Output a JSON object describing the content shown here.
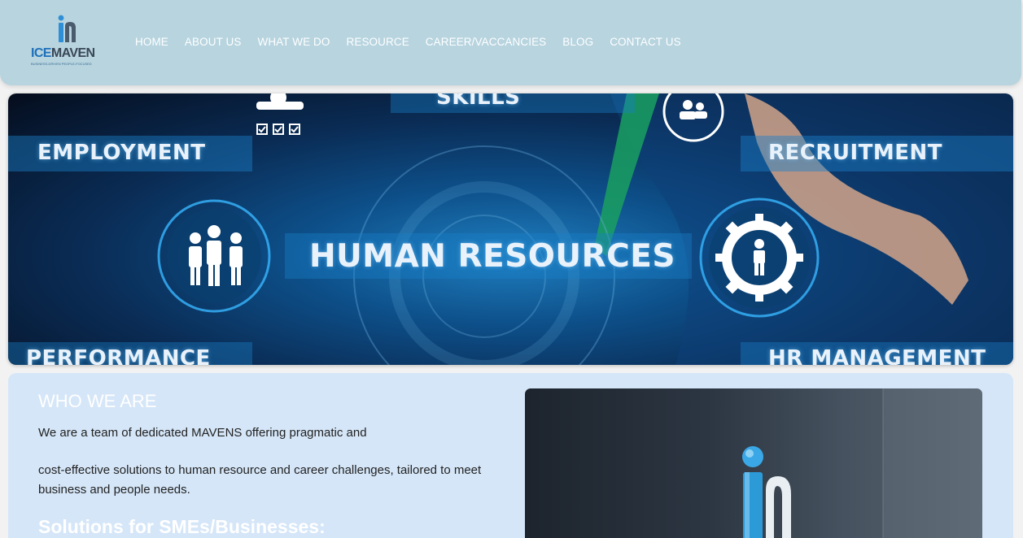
{
  "brand": {
    "name_part1": "ICE",
    "name_part2": "MAVEN",
    "tagline": "BUSINESS-DRIVEN PEOPLE-FOCUSED",
    "colors": {
      "header_bg": "#b7d4df",
      "primary_blue": "#1f70b9",
      "section_bg": "#d5e6f8"
    }
  },
  "nav": {
    "items": [
      "HOME",
      "ABOUT US",
      "WHAT WE DO",
      "RESOURCE",
      "CAREER/VACCANCIES",
      "BLOG",
      "CONTACT US"
    ]
  },
  "hero": {
    "main": "HUMAN RESOURCES",
    "employment": "EMPLOYMENT",
    "recruitment": "RECRUITMENT",
    "skills": "SKILLS",
    "performance": "PERFORMANCE",
    "hr_management": "HR MANAGEMENT",
    "icons": [
      "team-icon",
      "manager-icon",
      "people-icon",
      "gear-person-icon"
    ]
  },
  "about": {
    "title": "WHO WE ARE",
    "paragraph1": "We are a team of dedicated MAVENS offering pragmatic and",
    "paragraph2": "cost-effective solutions to human resource and career challenges, tailored to meet business and people needs.",
    "subtitle": "Solutions for SMEs/Businesses:"
  }
}
